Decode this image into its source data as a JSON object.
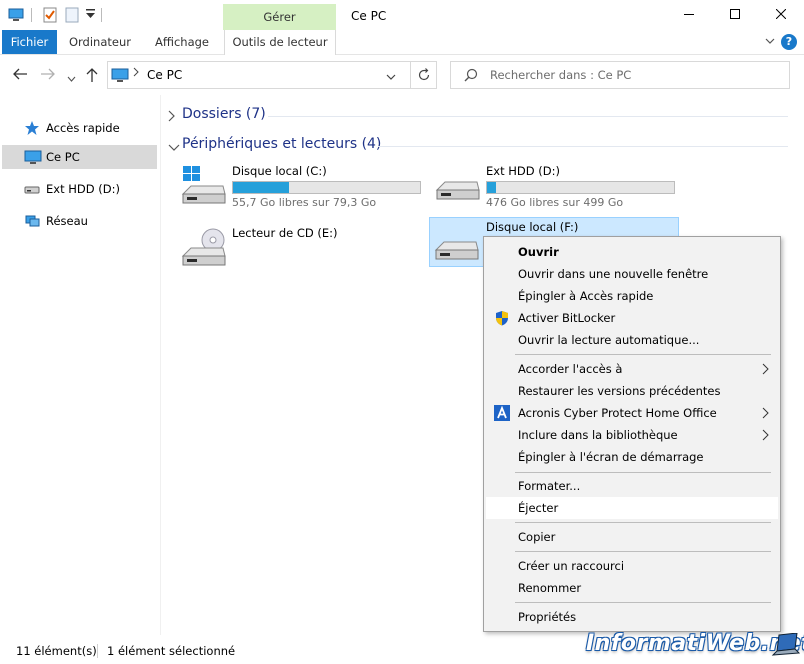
{
  "window": {
    "title": "Ce PC",
    "manage_tab": "Gérer"
  },
  "ribbon": {
    "tabs": [
      {
        "label": "Fichier"
      },
      {
        "label": "Ordinateur"
      },
      {
        "label": "Affichage"
      },
      {
        "label": "Outils de lecteur"
      }
    ]
  },
  "address": {
    "path": "Ce PC",
    "search_placeholder": "Rechercher dans : Ce PC"
  },
  "sidebar": {
    "items": [
      {
        "label": "Accès rapide",
        "icon": "star-icon"
      },
      {
        "label": "Ce PC",
        "icon": "computer-icon",
        "selected": true
      },
      {
        "label": "Ext HDD (D:)",
        "icon": "drive-icon"
      },
      {
        "label": "Réseau",
        "icon": "network-icon"
      }
    ]
  },
  "groups": {
    "folders": "Dossiers (7)",
    "devices": "Périphériques et lecteurs (4)"
  },
  "drives": [
    {
      "name": "Disque local (C:)",
      "free": "55,7 Go libres sur 79,3 Go",
      "used_fraction": 0.3
    },
    {
      "name": "Ext HDD (D:)",
      "free": "476 Go libres sur 499 Go",
      "used_fraction": 0.05
    },
    {
      "name": "Lecteur de CD (E:)"
    },
    {
      "name": "Disque local (F:)",
      "selected": true
    }
  ],
  "context_menu": {
    "items": [
      {
        "label": "Ouvrir",
        "bold": true
      },
      {
        "label": "Ouvrir dans une nouvelle fenêtre"
      },
      {
        "label": "Épingler à Accès rapide"
      },
      {
        "label": "Activer BitLocker",
        "icon": "shield-icon"
      },
      {
        "label": "Ouvrir la lecture automatique..."
      },
      {
        "label": "Accorder l'accès à",
        "submenu": true
      },
      {
        "label": "Restaurer les versions précédentes"
      },
      {
        "label": "Acronis Cyber Protect Home Office",
        "icon": "acronis-icon",
        "submenu": true
      },
      {
        "label": "Inclure dans la bibliothèque",
        "submenu": true
      },
      {
        "label": "Épingler à l'écran de démarrage"
      },
      {
        "label": "Formater..."
      },
      {
        "label": "Éjecter",
        "hover": true
      },
      {
        "label": "Copier"
      },
      {
        "label": "Créer un raccourci"
      },
      {
        "label": "Renommer"
      },
      {
        "label": "Propriétés"
      }
    ]
  },
  "status": {
    "count": "11 élément(s)",
    "selection": "1 élément sélectionné"
  },
  "watermark": "InformatiWeb.net",
  "colors": {
    "accent": "#1979ca",
    "selection": "#cce8ff",
    "progress": "#26a0da",
    "manage_tab": "#d6f0c3",
    "group_heading": "#1e3287"
  }
}
